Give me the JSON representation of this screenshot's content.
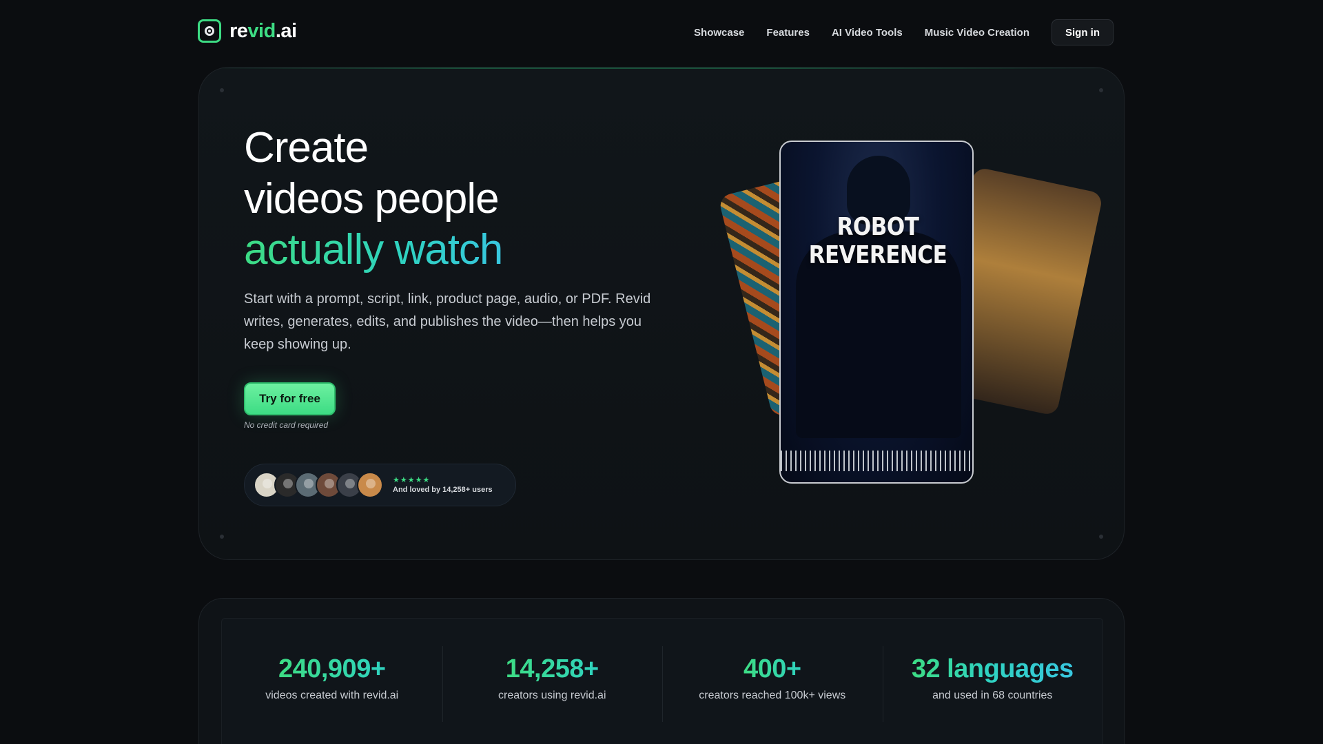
{
  "logo": {
    "text_main": "re",
    "text_accent": "vid",
    "text_suffix": ".ai",
    "icon": "revid-logo-icon",
    "accent_color": "#3ddc84"
  },
  "nav": {
    "items": [
      {
        "label": "Showcase"
      },
      {
        "label": "Features"
      },
      {
        "label": "AI Video Tools"
      },
      {
        "label": "Music Video Creation"
      }
    ],
    "signin_label": "Sign in"
  },
  "hero": {
    "line1": "Create",
    "line2": "videos people",
    "line3": "actually watch",
    "subtext": "Start with a prompt, script, link, product page, audio, or PDF. Revid writes, generates, edits, and publishes the video—then helps you keep showing up.",
    "cta_label": "Try for free",
    "cta_note": "No credit card required",
    "rating_stars": "★★★★★",
    "loved_text": "And loved by 14,258+ users",
    "avatar_colors": [
      "#d9d4c6",
      "#2a2a2a",
      "#5b6b74",
      "#6e4a3a",
      "#3a3f48",
      "#c98a4a"
    ]
  },
  "preview": {
    "title": "ROBOT REVERENCE"
  },
  "stats": [
    {
      "value": "240,909+",
      "label": "videos created with revid.ai"
    },
    {
      "value": "14,258+",
      "label": "creators using revid.ai"
    },
    {
      "value": "400+",
      "label": "creators reached 100k+ views"
    },
    {
      "value": "32 languages",
      "label": "and used in 68 countries"
    }
  ]
}
